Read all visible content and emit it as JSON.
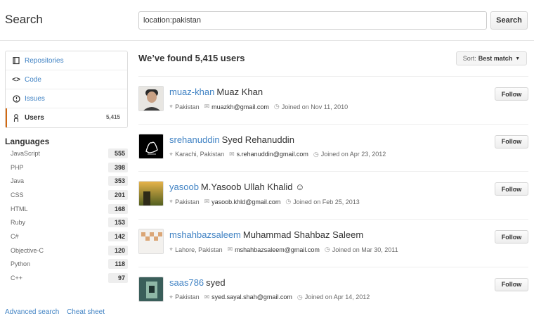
{
  "header": {
    "title": "Search",
    "query": "location:pakistan",
    "search_button": "Search"
  },
  "sidenav": {
    "items": [
      {
        "label": "Repositories",
        "icon": "repo-icon"
      },
      {
        "label": "Code",
        "icon": "code-icon"
      },
      {
        "label": "Issues",
        "icon": "issue-icon"
      },
      {
        "label": "Users",
        "icon": "person-icon",
        "count": "5,415",
        "selected": true
      }
    ]
  },
  "languages": {
    "title": "Languages",
    "items": [
      {
        "name": "JavaScript",
        "count": "555"
      },
      {
        "name": "PHP",
        "count": "398"
      },
      {
        "name": "Java",
        "count": "353"
      },
      {
        "name": "CSS",
        "count": "201"
      },
      {
        "name": "HTML",
        "count": "168"
      },
      {
        "name": "Ruby",
        "count": "153"
      },
      {
        "name": "C#",
        "count": "142"
      },
      {
        "name": "Objective-C",
        "count": "120"
      },
      {
        "name": "Python",
        "count": "118"
      },
      {
        "name": "C++",
        "count": "97"
      }
    ]
  },
  "footer": {
    "advanced_search": "Advanced search",
    "cheat_sheet": "Cheat sheet"
  },
  "results": {
    "heading": "We’ve found 5,415 users",
    "sort_label": "Sort:",
    "sort_value": "Best match",
    "follow_label": "Follow",
    "users": [
      {
        "login": "muaz-khan",
        "name": "Muaz Khan",
        "location": "Pakistan",
        "email": "muazkh@gmail.com",
        "joined": "Joined on Nov 11, 2010"
      },
      {
        "login": "srehanuddin",
        "name": "Syed Rehanuddin",
        "location": "Karachi, Pakistan",
        "email": "s.rehanuddin@gmail.com",
        "joined": "Joined on Apr 23, 2012"
      },
      {
        "login": "yasoob",
        "name": "M.Yasoob Ullah Khalid ☺",
        "location": "Pakistan",
        "email": "yasoob.khld@gmail.com",
        "joined": "Joined on Feb 25, 2013"
      },
      {
        "login": "mshahbazsaleem",
        "name": "Muhammad Shahbaz Saleem",
        "location": "Lahore, Pakistan",
        "email": "mshahbazsaleem@gmail.com",
        "joined": "Joined on Mar 30, 2011"
      },
      {
        "login": "saas786",
        "name": "syed",
        "location": "Pakistan",
        "email": "syed.sayal.shah@gmail.com",
        "joined": "Joined on Apr 14, 2012"
      }
    ]
  },
  "colors": {
    "link": "#4183c4",
    "selected_accent": "#d26911",
    "text": "#333333"
  }
}
